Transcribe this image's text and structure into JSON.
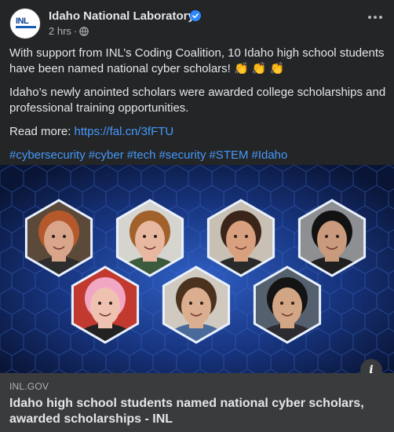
{
  "header": {
    "page_name": "Idaho National Laboratory",
    "timestamp": "2 hrs",
    "separator": "·",
    "avatar_text": "INL"
  },
  "body": {
    "para1": "With support from INL’s Coding Coalition, 10 Idaho high school students have been named national cyber scholars! 👏 👏 👏",
    "para2": "Idaho’s newly anointed scholars were awarded college scholarships and professional training opportunities.",
    "read_more_label": "Read more: ",
    "read_more_link": "https://fal.cn/3fFTU",
    "hashtags": [
      "#cybersecurity",
      "#cyber",
      "#tech",
      "#security",
      "#STEM",
      "#Idaho"
    ]
  },
  "image": {
    "people": [
      {
        "name": "person-1",
        "skin": "#d9a58a",
        "hair": "#b5582c",
        "shirt": "#2d2d2d",
        "bg": "#5b4a3a"
      },
      {
        "name": "person-2",
        "skin": "#e8b7a0",
        "hair": "#a0622a",
        "shirt": "#3c5a3c",
        "bg": "#d6d4cf"
      },
      {
        "name": "person-3",
        "skin": "#d8a07e",
        "hair": "#3a2518",
        "shirt": "#2a2a2a",
        "bg": "#c8c0b4"
      },
      {
        "name": "person-4",
        "skin": "#c99a7c",
        "hair": "#121212",
        "shirt": "#1f1f1f",
        "bg": "#8d8f93"
      },
      {
        "name": "person-5",
        "skin": "#efc1b0",
        "hair": "#f1a7c4",
        "shirt": "#222222",
        "bg": "#c23a2f"
      },
      {
        "name": "person-6",
        "skin": "#dcae90",
        "hair": "#4a321e",
        "shirt": "#4a6a9a",
        "bg": "#d0c9bf"
      },
      {
        "name": "person-7",
        "skin": "#d2a585",
        "hair": "#141414",
        "shirt": "#2b2b30",
        "bg": "#55606e"
      }
    ]
  },
  "preview": {
    "domain": "INL.GOV",
    "title": "Idaho high school students named national cyber scholars, awarded scholarships - INL"
  },
  "colors": {
    "background": "#242526",
    "link": "#4599ff",
    "verified": "#2d88ff",
    "preview_bg": "#3a3b3c"
  },
  "icons": [
    "verified-badge-icon",
    "globe-icon",
    "more-options-icon",
    "info-icon"
  ]
}
